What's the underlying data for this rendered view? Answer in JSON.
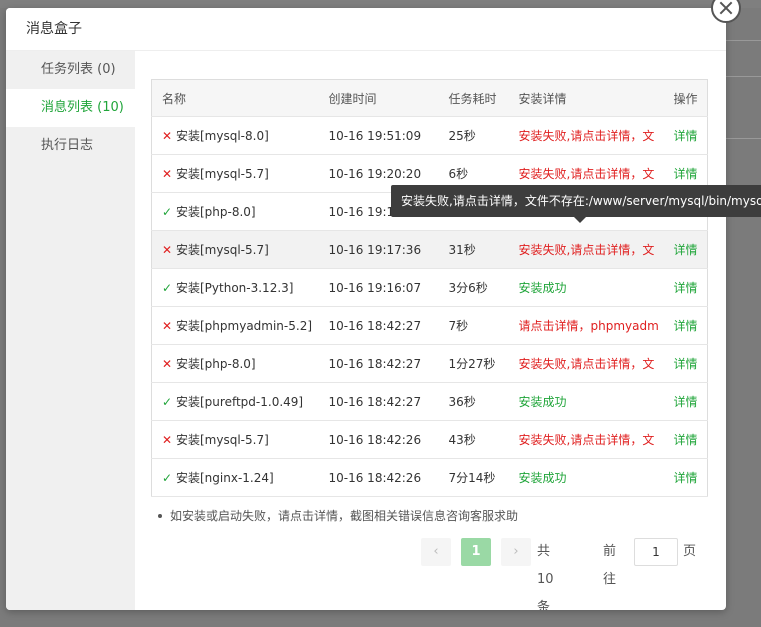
{
  "modal": {
    "title": "消息盒子"
  },
  "sidebar": {
    "items": [
      {
        "label": "任务列表 (0)",
        "active": false
      },
      {
        "label": "消息列表 (10)",
        "active": true
      },
      {
        "label": "执行日志",
        "active": false
      }
    ]
  },
  "table": {
    "headers": [
      "名称",
      "创建时间",
      "任务耗时",
      "安装详情",
      "操作"
    ],
    "rows": [
      {
        "status": "fail",
        "status_icon": "✕",
        "name": "安装[mysql-8.0]",
        "time": "10-16 19:51:09",
        "duration": "25秒",
        "detail": "安装失败,请点击详情，文",
        "action": "详情"
      },
      {
        "status": "fail",
        "status_icon": "✕",
        "name": "安装[mysql-5.7]",
        "time": "10-16 19:20:20",
        "duration": "6秒",
        "detail": "安装失败,请点击详情，文",
        "action": "详情"
      },
      {
        "status": "ok",
        "status_icon": "✓",
        "name": "安装[php-8.0]",
        "time": "10-16 19:1",
        "duration": "",
        "detail": "",
        "action": ""
      },
      {
        "status": "fail",
        "status_icon": "✕",
        "name": "安装[mysql-5.7]",
        "time": "10-16 19:17:36",
        "duration": "31秒",
        "detail": "安装失败,请点击详情，文",
        "action": "详情"
      },
      {
        "status": "ok",
        "status_icon": "✓",
        "name": "安装[Python-3.12.3]",
        "time": "10-16 19:16:07",
        "duration": "3分6秒",
        "detail": "安装成功",
        "action": "详情"
      },
      {
        "status": "fail",
        "status_icon": "✕",
        "name": "安装[phpmyadmin-5.2]",
        "time": "10-16 18:42:27",
        "duration": "7秒",
        "detail": "请点击详情，phpmyadm",
        "action": "详情"
      },
      {
        "status": "fail",
        "status_icon": "✕",
        "name": "安装[php-8.0]",
        "time": "10-16 18:42:27",
        "duration": "1分27秒",
        "detail": "安装失败,请点击详情，文",
        "action": "详情"
      },
      {
        "status": "ok",
        "status_icon": "✓",
        "name": "安装[pureftpd-1.0.49]",
        "time": "10-16 18:42:27",
        "duration": "36秒",
        "detail": "安装成功",
        "action": "详情"
      },
      {
        "status": "fail",
        "status_icon": "✕",
        "name": "安装[mysql-5.7]",
        "time": "10-16 18:42:26",
        "duration": "43秒",
        "detail": "安装失败,请点击详情，文",
        "action": "详情"
      },
      {
        "status": "ok",
        "status_icon": "✓",
        "name": "安装[nginx-1.24]",
        "time": "10-16 18:42:26",
        "duration": "7分14秒",
        "detail": "安装成功",
        "action": "详情"
      }
    ]
  },
  "tip": "如安装或启动失败，请点击详情，截图相关错误信息咨询客服求助",
  "pager": {
    "prev": "‹",
    "current": "1",
    "next": "›",
    "total": "共 10 条",
    "goto_label": "前往",
    "goto_value": "1",
    "page_unit": "页"
  },
  "tooltip": "安装失败,请点击详情，文件不存在:/www/server/mysql/bin/mysql",
  "colors": {
    "accent": "#20a53a",
    "error": "#e02020"
  }
}
